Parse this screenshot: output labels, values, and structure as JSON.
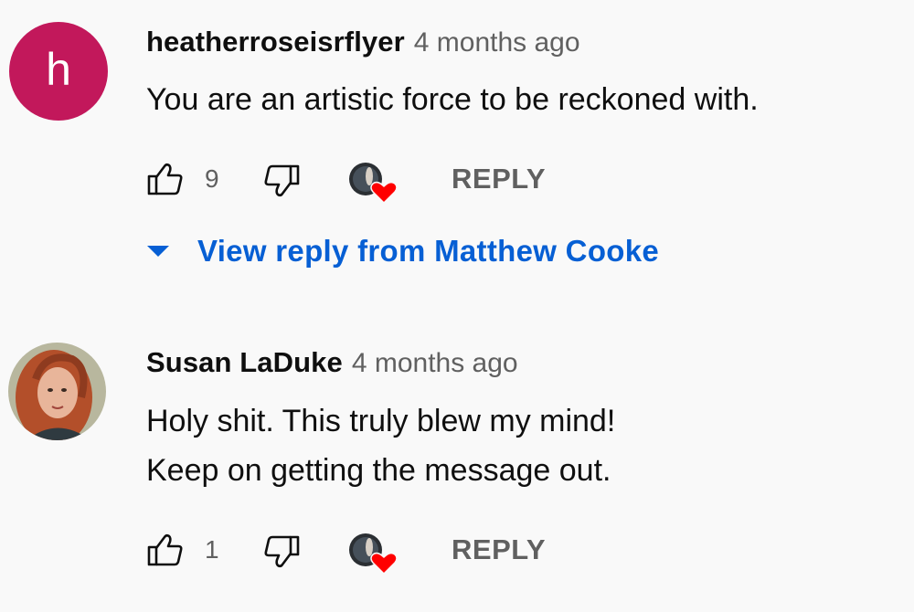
{
  "comments": [
    {
      "avatar_letter": "h",
      "author": "heatherroseisrflyer",
      "time": "4 months ago",
      "text_lines": [
        "You are an artistic force to be reckoned with."
      ],
      "likes": "9",
      "reply_label": "REPLY",
      "view_replies_label": "View reply from Matthew Cooke"
    },
    {
      "author": "Susan LaDuke",
      "time": "4 months ago",
      "text_lines": [
        "Holy shit. This truly blew my mind!",
        "Keep on getting the message out."
      ],
      "likes": "1",
      "reply_label": "REPLY"
    }
  ],
  "colors": {
    "avatar_bg": "#c2185b",
    "link_blue": "#065fd4",
    "heart_red": "#ff0000",
    "meta_gray": "#606060"
  },
  "icons": [
    "thumbs-up-icon",
    "thumbs-down-icon",
    "creator-heart-icon",
    "chevron-down-icon"
  ]
}
